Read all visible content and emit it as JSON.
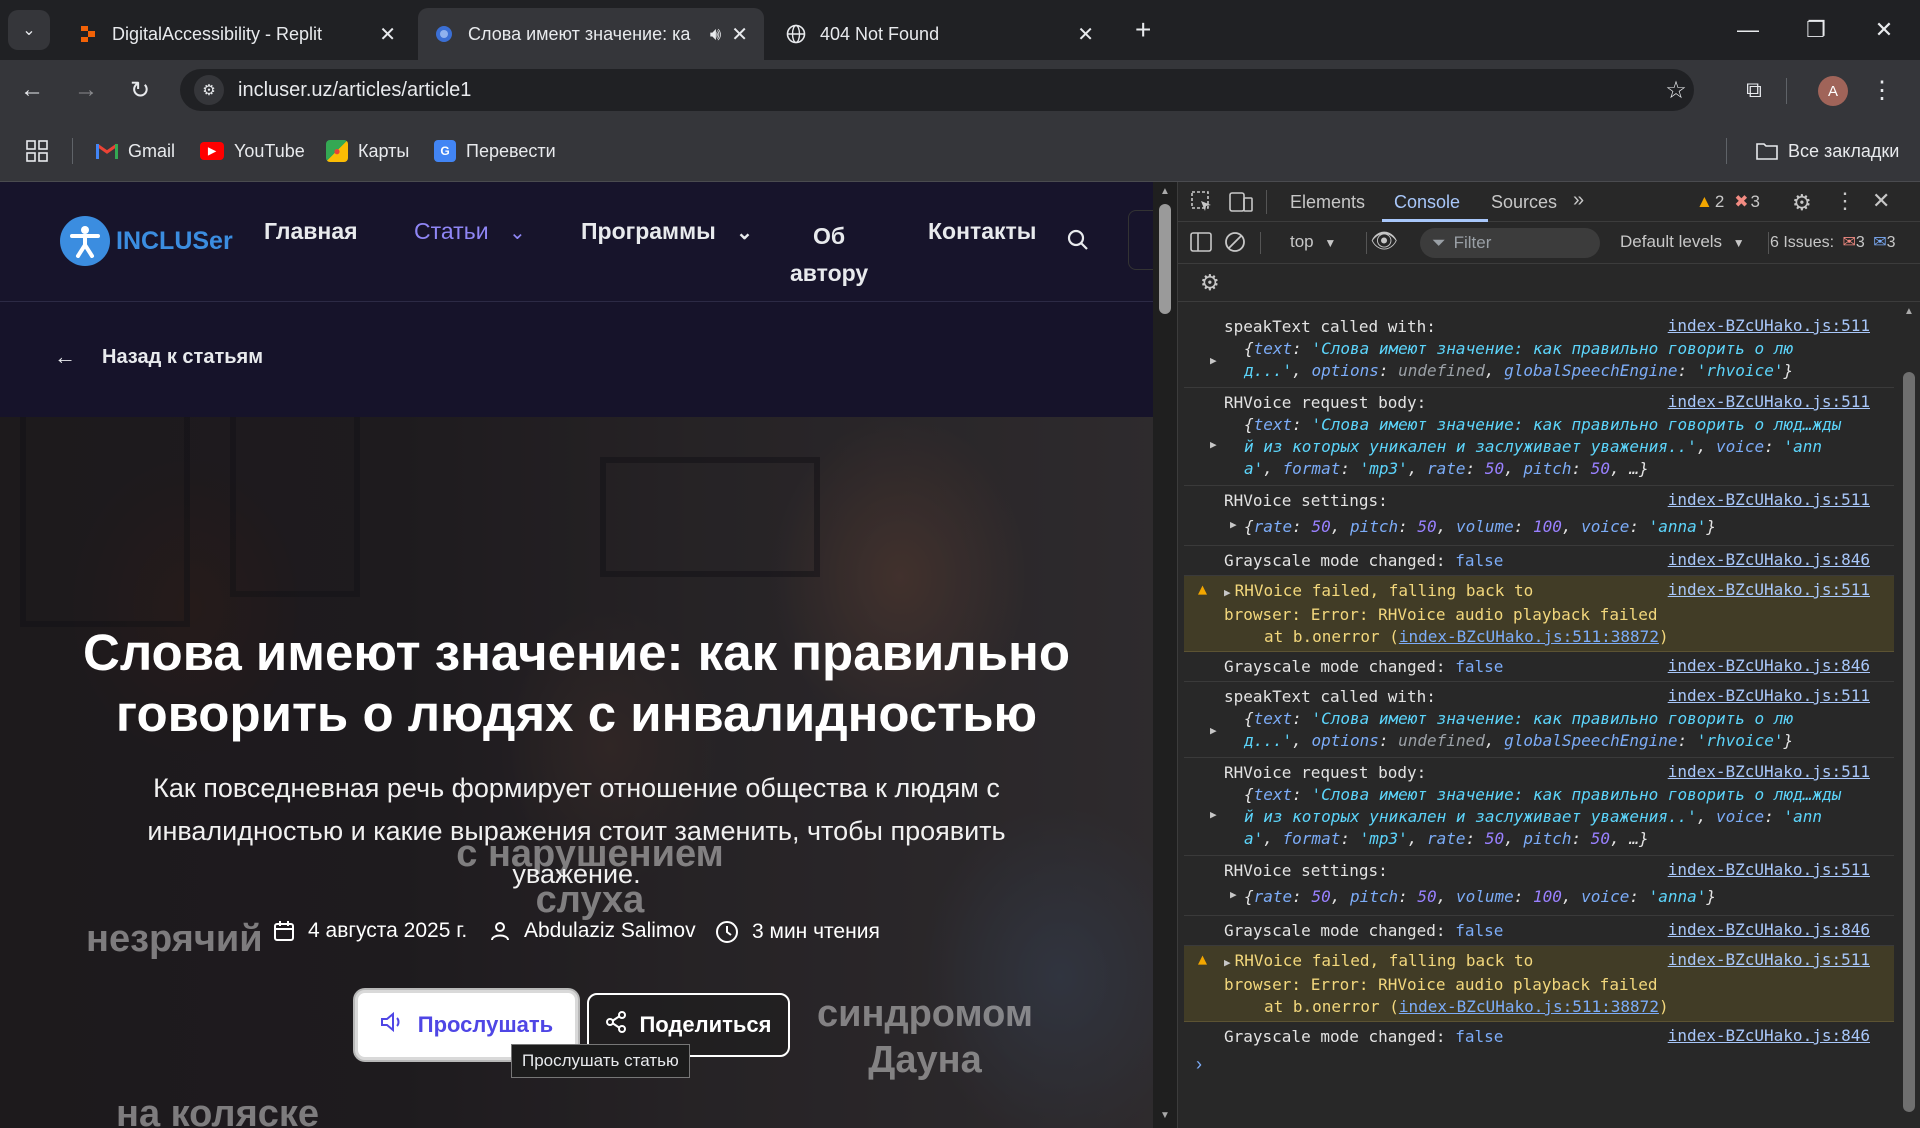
{
  "browser": {
    "tabs": [
      {
        "title": "DigitalAccessibility - Replit",
        "active": false
      },
      {
        "title": "Слова имеют значение: ка",
        "active": true
      },
      {
        "title": "404 Not Found",
        "active": false
      }
    ],
    "url": "incluser.uz/articles/article1",
    "profile_initial": "A",
    "bookmarks": [
      "Gmail",
      "YouTube",
      "Карты",
      "Перевести"
    ],
    "all_bookmarks": "Все закладки"
  },
  "site": {
    "logo": "INCLUSer",
    "nav": {
      "home": "Главная",
      "articles": "Статьи",
      "programs": "Программы",
      "about_line1": "Об",
      "about_line2": "автору",
      "contacts": "Контакты"
    },
    "back": "Назад к статьям",
    "title": "Слова имеют значение: как правильно говорить о людях с инвалидностью",
    "subtitle": "Как повседневная речь формирует отношение общества к людям с инвалидностью и какие выражения стоит заменить, чтобы проявить уважение.",
    "ghost_labels": {
      "hearing_line1": "с нарушением",
      "hearing_line2": "слуха",
      "blind": "незрячий",
      "down_line1": "синдромом",
      "down_line2": "Дауна",
      "wheelchair": "на коляске"
    },
    "meta": {
      "date": "4 августа 2025 г.",
      "author": "Abdulaziz Salimov",
      "read_time": "3 мин чтения"
    },
    "listen_button": "Прослушать",
    "share_button": "Поделиться",
    "tooltip": "Прослушать статью"
  },
  "devtools": {
    "tabs": [
      "Elements",
      "Console",
      "Sources"
    ],
    "active_tab": "Console",
    "warnings_count": "2",
    "errors_count": "3",
    "context": "top",
    "filter_placeholder": "Filter",
    "levels": "Default levels",
    "issues_label": "6 Issues:",
    "issues_errors": "3",
    "issues_info": "3",
    "logs": [
      {
        "src": "index-BZcUHako.js:511",
        "l1": "speakText called with:"
      },
      {
        "src": "index-BZcUHako.js:511",
        "l1": "RHVoice request body:"
      },
      {
        "src": "index-BZcUHako.js:511",
        "l1": "RHVoice settings:"
      },
      {
        "src": "index-BZcUHako.js:846",
        "l1": "Grayscale mode changed: ",
        "val": "false"
      },
      {
        "src": "index-BZcUHako.js:511",
        "l1": "RHVoice failed, falling back to",
        "l2": "browser: Error: RHVoice audio playback failed",
        "l3": "at b.onerror (",
        "link": "index-BZcUHako.js:511:38872",
        "l3end": ")"
      },
      {
        "src": "index-BZcUHako.js:846",
        "l1": "Grayscale mode changed: ",
        "val": "false"
      },
      {
        "src": "index-BZcUHako.js:511",
        "l1": "speakText called with:"
      },
      {
        "src": "index-BZcUHako.js:511",
        "l1": "RHVoice request body:"
      },
      {
        "src": "index-BZcUHako.js:511",
        "l1": "RHVoice settings:"
      },
      {
        "src": "index-BZcUHako.js:846",
        "l1": "Grayscale mode changed: ",
        "val": "false"
      },
      {
        "src": "index-BZcUHako.js:511",
        "l1": "RHVoice failed, falling back to",
        "l2": "browser: Error: RHVoice audio playback failed",
        "l3": "at b.onerror (",
        "link": "index-BZcUHako.js:511:38872",
        "l3end": ")"
      },
      {
        "src": "index-BZcUHako.js:846",
        "l1": "Grayscale mode changed: ",
        "val": "false"
      }
    ],
    "obj_speak": {
      "text_key": "text",
      "text_val": "'Слова имеют значение: как правильно говорить о лю",
      "text_val2": "д...'",
      "opt_key": "options",
      "opt_val": "undefined",
      "eng_key": "globalSpeechEngine",
      "eng_val": "'rhvoice'"
    },
    "obj_body": {
      "text_key": "text",
      "line1": "'Слова имеют значение: как правильно говорить о люд…жды",
      "line2": "й из которых уникален и заслуживает уважения..'",
      "voice_key": "voice",
      "voice_val": "'ann",
      "line3": "a'",
      "format_key": "format",
      "format_val": "'mp3'",
      "rate_key": "rate",
      "rate_val": "50",
      "pitch_key": "pitch",
      "pitch_val": "50",
      "rest": "…}"
    },
    "obj_settings": {
      "rate_key": "rate",
      "rate_val": "50",
      "pitch_key": "pitch",
      "pitch_val": "50",
      "volume_key": "volume",
      "volume_val": "100",
      "voice_key": "voice",
      "voice_val": "'anna'"
    }
  }
}
